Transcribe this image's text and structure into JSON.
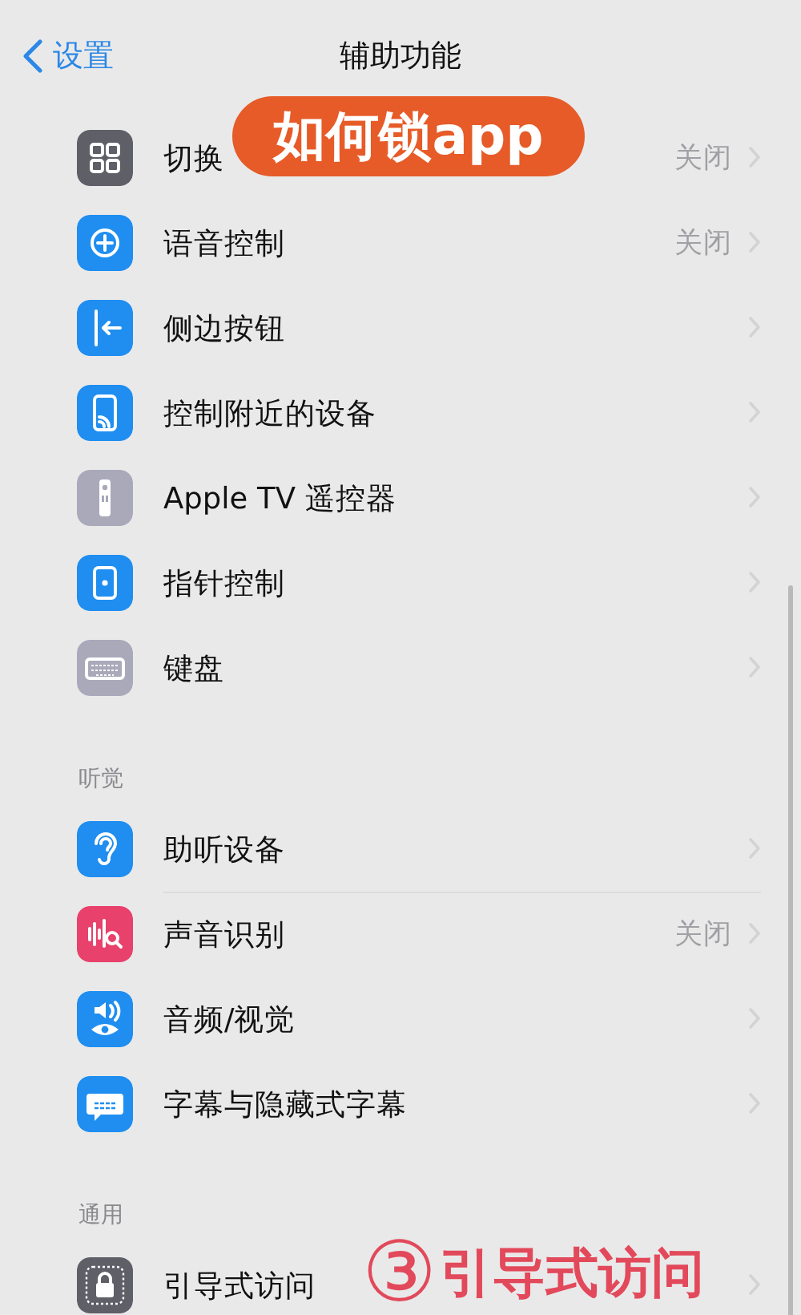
{
  "nav": {
    "back": "设置",
    "title": "辅助功能"
  },
  "sections": [
    {
      "rows": [
        {
          "label": "切换",
          "value": "关闭",
          "color": "#5f5f68"
        },
        {
          "label": "语音控制",
          "value": "关闭",
          "color": "#1f8ef0"
        },
        {
          "label": "侧边按钮",
          "color": "#1f8ef0"
        },
        {
          "label": "控制附近的设备",
          "color": "#1f8ef0"
        },
        {
          "label": "Apple TV 遥控器",
          "color": "#a9a9ba"
        },
        {
          "label": "指针控制",
          "color": "#1f8ef0"
        },
        {
          "label": "键盘",
          "color": "#a9a9ba"
        }
      ]
    },
    {
      "header": "听觉",
      "rows": [
        {
          "label": "助听设备",
          "color": "#1f8ef0"
        },
        {
          "label": "声音识别",
          "value": "关闭",
          "color": "#e8416b"
        },
        {
          "label": "音频/视觉",
          "color": "#1f8ef0"
        },
        {
          "label": "字幕与隐藏式字幕",
          "color": "#1f8ef0"
        }
      ]
    },
    {
      "header": "通用",
      "rows": [
        {
          "label": "引导式访问",
          "color": "#5f5f68"
        }
      ]
    }
  ],
  "overlays": {
    "badge": "如何锁app",
    "caption_number": "③",
    "caption": "引导式访问"
  }
}
